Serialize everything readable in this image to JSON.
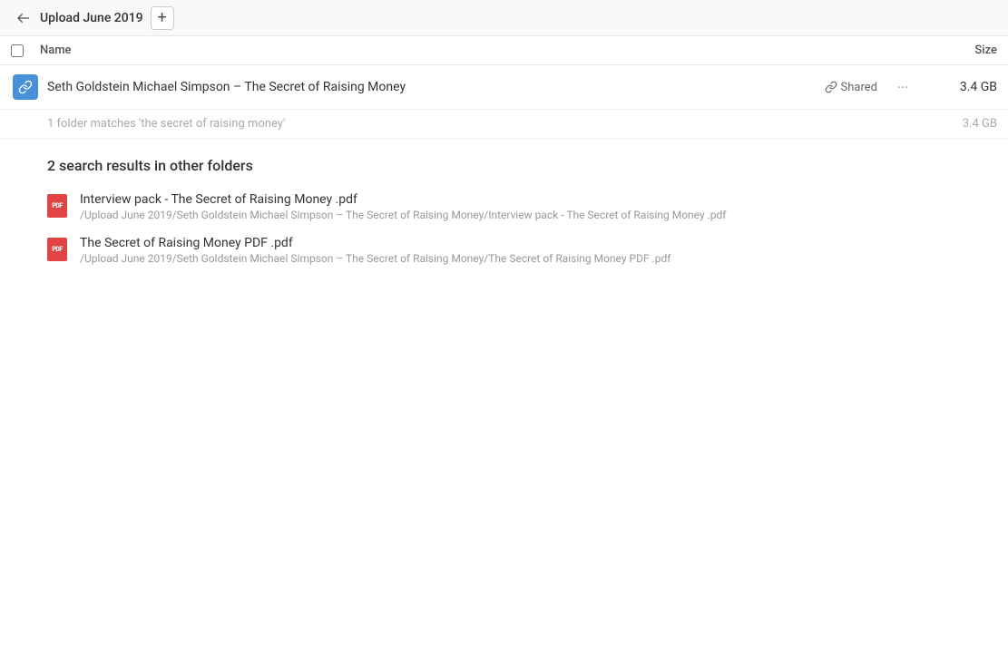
{
  "header": {
    "back_icon": "←",
    "title": "Upload June 2019",
    "add_icon": "+"
  },
  "columns": {
    "name_label": "Name",
    "size_label": "Size"
  },
  "folder": {
    "name": "Seth Goldstein Michael Simpson – The Secret of Raising Money",
    "shared_label": "Shared",
    "more_icon": "···",
    "size": "3.4 GB"
  },
  "match_info": {
    "text": "1 folder matches 'the secret of raising money'",
    "size": "3.4 GB"
  },
  "other_section": {
    "header": "2 search results in other folders"
  },
  "results": [
    {
      "filename": "Interview pack - The Secret of Raising Money .pdf",
      "path": "/Upload June 2019/Seth Goldstein Michael Simpson – The Secret of Raising Money/Interview pack - The Secret of Raising Money .pdf"
    },
    {
      "filename": "The Secret of Raising Money PDF .pdf",
      "path": "/Upload June 2019/Seth Goldstein Michael Simpson – The Secret of Raising Money/The Secret of Raising Money PDF .pdf"
    }
  ]
}
